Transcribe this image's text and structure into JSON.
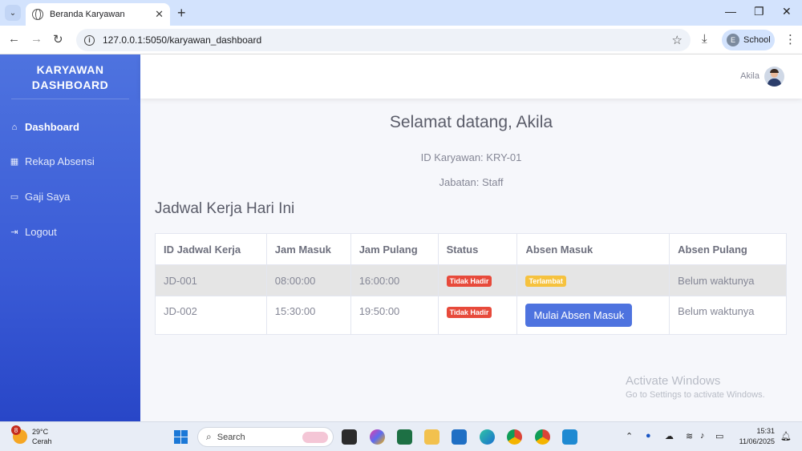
{
  "browser": {
    "tab_title": "Beranda Karyawan",
    "url": "127.0.0.1:5050/karyawan_dashboard",
    "profile_label": "School",
    "profile_initial": "E"
  },
  "sidebar": {
    "brand_line1": "KARYAWAN",
    "brand_line2": "DASHBOARD",
    "items": [
      {
        "label": "Dashboard",
        "icon": "home-icon",
        "active": true
      },
      {
        "label": "Rekap Absensi",
        "icon": "calendar-icon",
        "active": false
      },
      {
        "label": "Gaji Saya",
        "icon": "money-icon",
        "active": false
      },
      {
        "label": "Logout",
        "icon": "logout-icon",
        "active": false
      }
    ]
  },
  "header": {
    "user_name": "Akila"
  },
  "main": {
    "welcome": "Selamat datang, Akila",
    "employee_id": "ID Karyawan: KRY-01",
    "position": "Jabatan: Staff",
    "schedule_title": "Jadwal Kerja Hari Ini",
    "table": {
      "headers": [
        "ID Jadwal Kerja",
        "Jam Masuk",
        "Jam Pulang",
        "Status",
        "Absen Masuk",
        "Absen Pulang"
      ],
      "rows": [
        {
          "id": "JD-001",
          "jam_masuk": "08:00:00",
          "jam_pulang": "16:00:00",
          "status": "Tidak Hadir",
          "absen_masuk": "Terlambat",
          "absen_pulang": "Belum waktunya"
        },
        {
          "id": "JD-002",
          "jam_masuk": "15:30:00",
          "jam_pulang": "19:50:00",
          "status": "Tidak Hadir",
          "absen_masuk": "Mulai Absen Masuk",
          "absen_pulang": "Belum waktunya"
        }
      ]
    }
  },
  "watermark": {
    "line1": "Activate Windows",
    "line2": "Go to Settings to activate Windows."
  },
  "taskbar": {
    "weather_temp": "29°C",
    "weather_desc": "Cerah",
    "weather_badge": "8",
    "search_placeholder": "Search",
    "time": "15:31",
    "date": "11/06/2025"
  },
  "colors": {
    "primary": "#4e73df",
    "danger": "#e74a3b",
    "warning": "#f6c23e"
  }
}
